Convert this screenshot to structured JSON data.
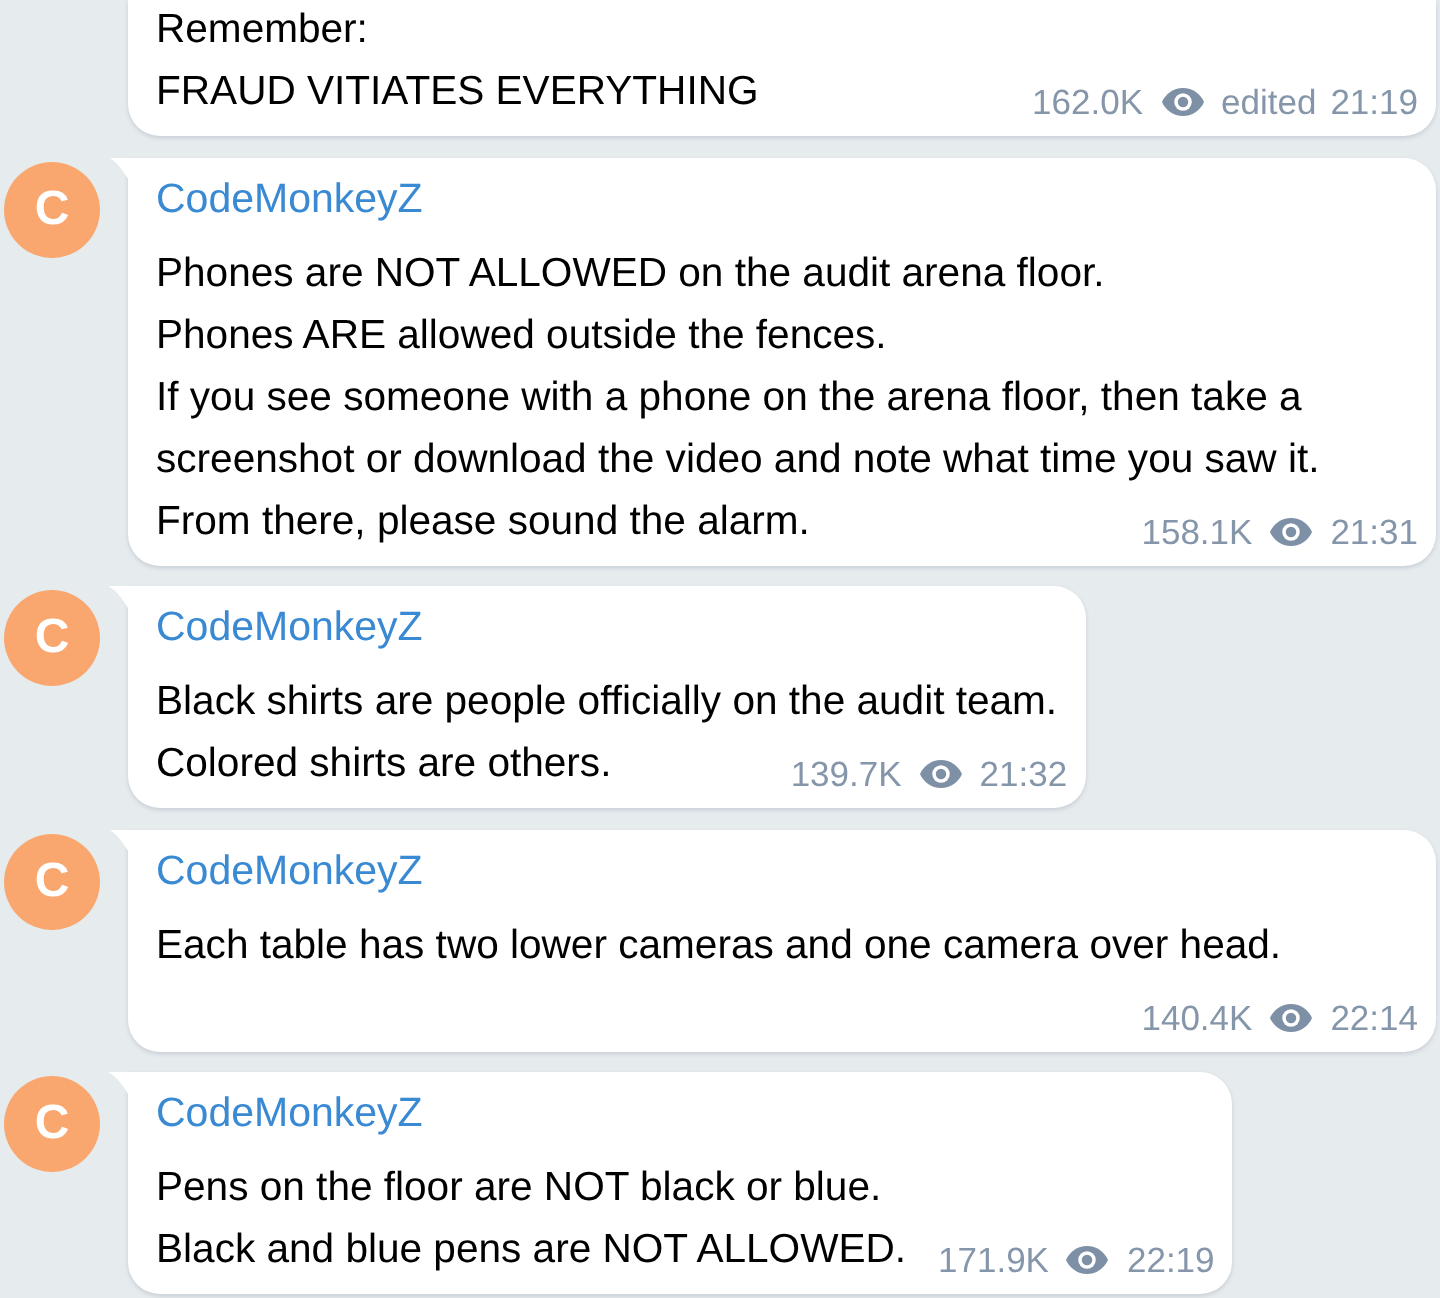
{
  "messages": [
    {
      "clipped": true,
      "lines": [
        "Remember:",
        "FRAUD VITIATES EVERYTHING"
      ],
      "views": "162.0K",
      "edit_note": "edited",
      "time": "21:19"
    },
    {
      "author": "CodeMonkeyZ",
      "avatar_letter": "C",
      "lines": [
        "Phones are NOT ALLOWED on the audit arena floor.",
        "Phones ARE allowed outside the fences.",
        "If you see someone with a phone on the arena floor, then take a screenshot or download the video and note what time you saw it.",
        "From there, please sound the alarm."
      ],
      "views": "158.1K",
      "time": "21:31"
    },
    {
      "author": "CodeMonkeyZ",
      "avatar_letter": "C",
      "lines": [
        "Black shirts are people officially on the audit team.",
        "Colored shirts are others."
      ],
      "views": "139.7K",
      "time": "21:32"
    },
    {
      "author": "CodeMonkeyZ",
      "avatar_letter": "C",
      "lines": [
        "Each table has two lower cameras and one camera over head."
      ],
      "views": "140.4K",
      "time": "22:14"
    },
    {
      "author": "CodeMonkeyZ",
      "avatar_letter": "C",
      "lines": [
        "Pens on the floor are NOT black or blue.",
        "Black and blue pens are NOT ALLOWED."
      ],
      "views": "171.9K",
      "time": "22:19"
    }
  ]
}
